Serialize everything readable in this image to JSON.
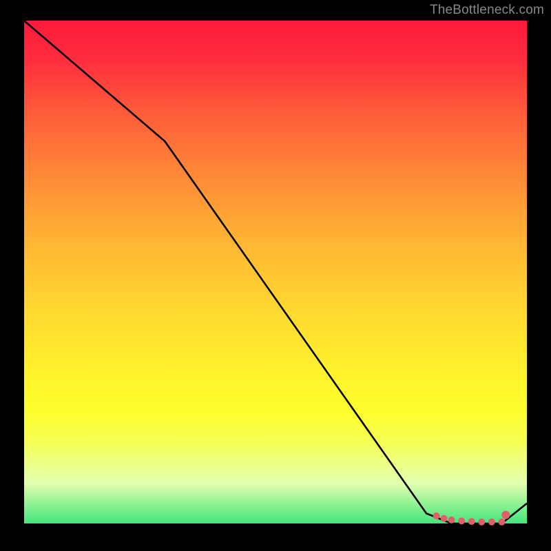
{
  "attribution": "TheBottleneck.com",
  "chart_data": {
    "type": "line",
    "title": "",
    "xlabel": "",
    "ylabel": "",
    "ylim": [
      0,
      100
    ],
    "xlim": [
      0,
      100
    ],
    "series": [
      {
        "name": "curve",
        "x": [
          0,
          28,
          80,
          85,
          95,
          100
        ],
        "y": [
          100,
          76,
          2,
          0,
          0,
          4
        ]
      }
    ],
    "markers": [
      {
        "x": 82,
        "y": 1.5
      },
      {
        "x": 83.5,
        "y": 1.0
      },
      {
        "x": 85,
        "y": 0.7
      },
      {
        "x": 87,
        "y": 0.5
      },
      {
        "x": 89,
        "y": 0.4
      },
      {
        "x": 91,
        "y": 0.3
      },
      {
        "x": 93,
        "y": 0.3
      },
      {
        "x": 95,
        "y": 0.3
      },
      {
        "x": 95.8,
        "y": 1.7
      }
    ],
    "colors": {
      "line": "#000000",
      "marker": "#e35f68",
      "gradient_top": "#ff193c",
      "gradient_bottom": "#43e67b"
    }
  }
}
